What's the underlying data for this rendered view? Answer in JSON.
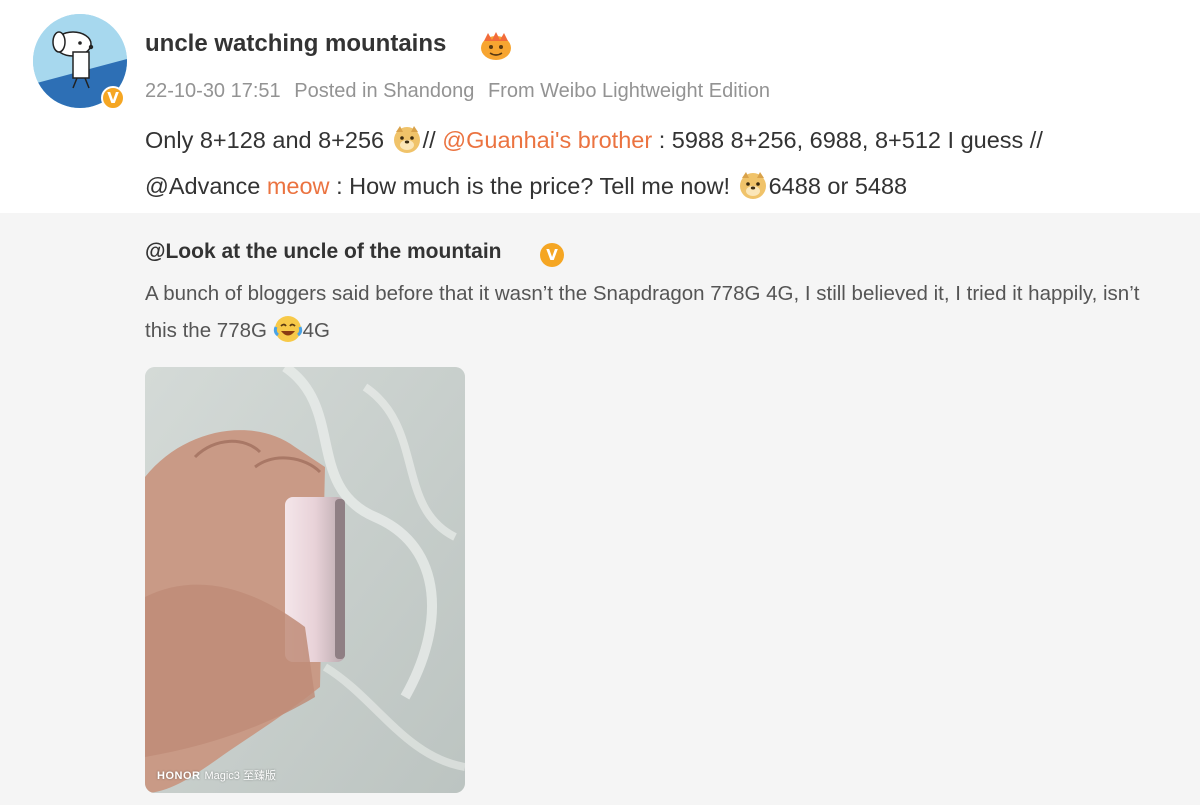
{
  "post": {
    "username": "uncle watching mountains",
    "verified_mark": "V",
    "timestamp": "22-10-30 17:51",
    "location": "Posted in Shandong",
    "source": "From Weibo Lightweight Edition",
    "text": {
      "part1": "Only 8+128 and 8+256",
      "sep1": "//",
      "mention1": "@Guanhai's brother",
      "part2": ": 5988 8+256, 6988, 8+512 I guess //",
      "mention2": "@Advance",
      "meow": "meow",
      "part3": ": How much is the price? Tell me now!",
      "part4": "6488 or 5488"
    }
  },
  "repost": {
    "username": "@Look at the uncle of the mountain",
    "verified_mark": "V",
    "text_part1": "A bunch of bloggers said before that it wasn’t the Snapdragon 778G 4G, I still believed it, I tried it happily, isn’t this the 778G",
    "text_part2": "4G",
    "image": {
      "watermark_brand": "HONOR",
      "watermark_model": "Magic3 至臻版"
    }
  },
  "colors": {
    "link": "#eb7340",
    "verified": "#f5a623",
    "repost_bg": "#f5f5f5"
  },
  "icons": [
    "avatar-dog",
    "verified-badge-icon",
    "fire-emoji-icon",
    "doge-emoji-icon",
    "laugh-cry-emoji-icon"
  ]
}
